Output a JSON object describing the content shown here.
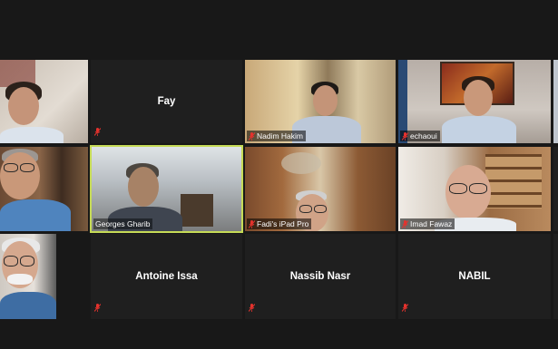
{
  "meeting": {
    "participants": [
      {
        "id": "p1",
        "name": "",
        "type": "video"
      },
      {
        "id": "p2",
        "name": "Fay",
        "type": "avatar"
      },
      {
        "id": "p3",
        "name": "Nadim Hakim",
        "type": "video"
      },
      {
        "id": "p4",
        "name": "echaoui",
        "type": "video"
      },
      {
        "id": "p5",
        "name": "",
        "type": "video"
      },
      {
        "id": "p6",
        "name": "Georges Gharib",
        "type": "video",
        "active_speaker": true
      },
      {
        "id": "p7",
        "name": "Fadi's iPad Pro",
        "type": "video"
      },
      {
        "id": "p8",
        "name": "Imad Fawaz",
        "type": "video"
      },
      {
        "id": "p9",
        "name": "",
        "type": "video"
      },
      {
        "id": "p10",
        "name": "Antoine Issa",
        "type": "avatar"
      },
      {
        "id": "p11",
        "name": "Nassib Nasr",
        "type": "avatar"
      },
      {
        "id": "p12",
        "name": "NABIL",
        "type": "avatar"
      }
    ],
    "colors": {
      "background": "#181818",
      "tile": "#1f1f1f",
      "active_speaker_border": "#c6db56",
      "mic_off": "#e5322d",
      "name_text": "#ffffff"
    },
    "icons": {
      "mute": "mic-off-icon"
    }
  }
}
